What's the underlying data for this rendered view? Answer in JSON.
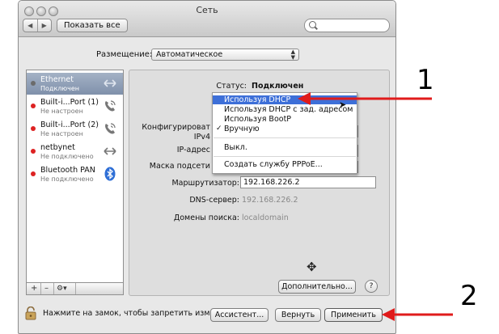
{
  "window": {
    "title": "Сеть"
  },
  "toolbar": {
    "back": "◀",
    "forward": "▶",
    "show_all": "Показать все",
    "search_placeholder": ""
  },
  "location": {
    "label": "Размещение:",
    "value": "Автоматическое"
  },
  "services": [
    {
      "name": "Ethernet",
      "status": "Подключен",
      "dot": "",
      "icon": "ethernet-arrows-icon",
      "selected": true
    },
    {
      "name": "Built-i...Port (1)",
      "status": "Не настроен",
      "dot": "red",
      "icon": "phone-icon"
    },
    {
      "name": "Built-i...Port (2)",
      "status": "Не настроен",
      "dot": "red",
      "icon": "phone-icon"
    },
    {
      "name": "netbynet",
      "status": "Не подключено",
      "dot": "red",
      "icon": "ethernet-arrows-icon"
    },
    {
      "name": "Bluetooth PAN",
      "status": "Не подключено",
      "dot": "red",
      "icon": "bluetooth-icon"
    }
  ],
  "sidebar_toolbar": {
    "add": "+",
    "remove": "–",
    "gear": "⚙▾"
  },
  "details": {
    "status_label": "Статус:",
    "status_value": "Подключен",
    "config_label_line1": "Конфигурироват",
    "config_label_line2": "IPv4",
    "ip_label": "IP-адрес",
    "mask_label": "Маска подсети",
    "router_label": "Маршрутизатор:",
    "router_value": "192.168.226.2",
    "dns_label": "DNS-сервер:",
    "dns_value": "192.168.226.2",
    "search_domains_label": "Домены поиска:",
    "search_domains_value": "localdomain",
    "advanced_button": "Дополнительно...",
    "help_button": "?"
  },
  "dropdown": {
    "items": [
      "Используя DHCP",
      "Используя DHCP с зад. адресом",
      "Используя BootP",
      "Вручную"
    ],
    "checkmark": "✓",
    "off": "Выкл.",
    "pppoe": "Создать службу PPPoE..."
  },
  "footer": {
    "lock_text": "Нажмите на замок, чтобы запретить изменения.",
    "assistant_button": "Ассистент...",
    "revert_button": "Вернуть",
    "apply_button": "Применить"
  },
  "annotations": {
    "one": "1",
    "two": "2"
  },
  "colors": {
    "arrow": "#e01b1b",
    "highlight": "#3d6fd8",
    "selection": "#8a9ab3"
  }
}
